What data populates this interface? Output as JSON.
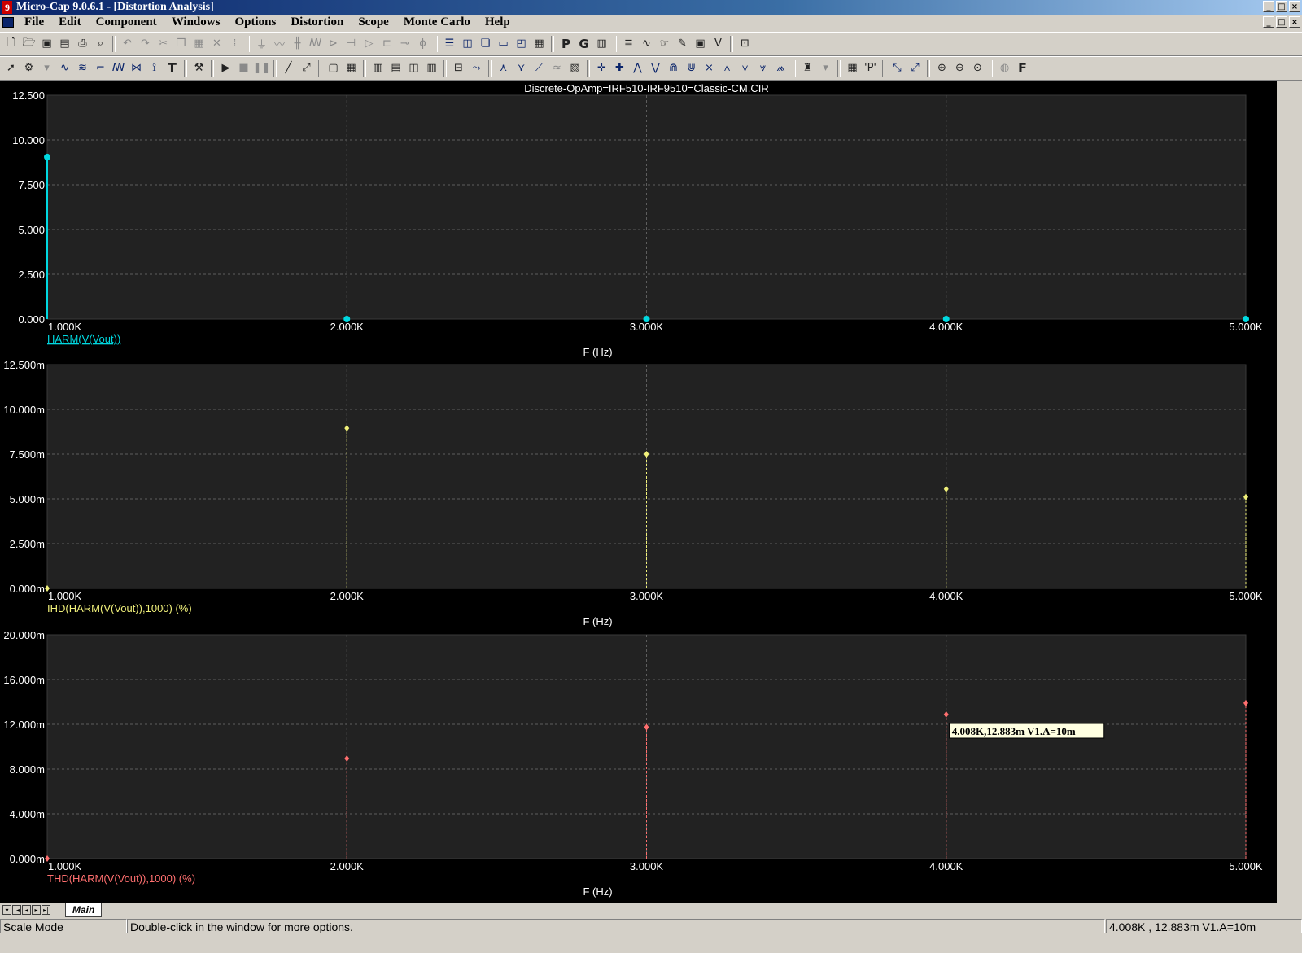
{
  "app": {
    "title": "Micro-Cap 9.0.6.1 - [Distortion Analysis]",
    "window_buttons": [
      "_",
      "□",
      "×"
    ]
  },
  "menu": {
    "items": [
      "File",
      "Edit",
      "Component",
      "Windows",
      "Options",
      "Distortion",
      "Scope",
      "Monte Carlo",
      "Help"
    ]
  },
  "toolbar": {
    "row1_icons": [
      "new-file-icon",
      "open-file-icon",
      "save-icon",
      "save-all-icon",
      "print-icon",
      "print-preview-icon",
      "undo-icon",
      "redo-icon",
      "cut-icon",
      "copy-icon",
      "paste-icon",
      "delete-icon",
      "select-all-icon",
      "ground-icon",
      "resistor-icon",
      "capacitor-icon",
      "inductor-icon",
      "diode-icon",
      "npn-icon",
      "opamp-icon",
      "window-split-icon",
      "calculator-icon",
      "probe-p-icon",
      "probe-g-icon",
      "grid-icon",
      "chart-icon"
    ],
    "row2_icons": [
      "select-arrow-icon",
      "component-mode-icon",
      "wire-icon",
      "text-tool-icon",
      "run-icon",
      "stop-icon",
      "pause-icon",
      "zoom-in-icon",
      "zoom-out-icon",
      "zoom-fit-icon",
      "font-f-icon"
    ],
    "font_label": "F",
    "probe_p": "P",
    "probe_g": "G"
  },
  "plot": {
    "title": "Discrete-OpAmp=IRF510-IRF9510=Classic-CM.CIR",
    "x_axis_label": "F (Hz)",
    "x_ticks": [
      "1.000K",
      "2.000K",
      "3.000K",
      "4.000K",
      "5.000K"
    ],
    "cursor_readout": "4.008K,12.883m V1.A=10m"
  },
  "chart_data": [
    {
      "type": "scatter",
      "style": "stem",
      "series": [
        {
          "name": "HARM(V(Vout))",
          "color": "#00d8e0",
          "values": [
            9.05,
            0.0,
            0.0,
            0.0,
            0.0
          ]
        }
      ],
      "x": [
        1000,
        2000,
        3000,
        4000,
        5000
      ],
      "xlabel": "F (Hz)",
      "ylim": [
        0,
        12.5
      ],
      "y_ticks": [
        "0.000",
        "2.500",
        "5.000",
        "7.500",
        "10.000",
        "12.500"
      ],
      "xlim": [
        1000,
        5000
      ],
      "grid": true
    },
    {
      "type": "scatter",
      "style": "stem",
      "series": [
        {
          "name": "IHD(HARM(V(Vout)),1000) (%)",
          "color": "#f0f07a",
          "values": [
            0.0,
            8.95,
            7.5,
            5.55,
            5.1
          ]
        }
      ],
      "x": [
        1000,
        2000,
        3000,
        4000,
        5000
      ],
      "xlabel": "F (Hz)",
      "ylim": [
        0,
        12.5
      ],
      "y_ticks": [
        "0.000m",
        "2.500m",
        "5.000m",
        "7.500m",
        "10.000m",
        "12.500m"
      ],
      "xlim": [
        1000,
        5000
      ],
      "grid": true
    },
    {
      "type": "scatter",
      "style": "stem",
      "series": [
        {
          "name": "THD(HARM(V(Vout)),1000) (%)",
          "color": "#ff6f6f",
          "values": [
            0.0,
            8.95,
            11.75,
            12.883,
            13.9
          ]
        }
      ],
      "x": [
        1000,
        2000,
        3000,
        4000,
        5000
      ],
      "xlabel": "F (Hz)",
      "ylim": [
        0,
        20
      ],
      "y_ticks": [
        "0.000m",
        "4.000m",
        "8.000m",
        "12.000m",
        "16.000m",
        "20.000m"
      ],
      "xlim": [
        1000,
        5000
      ],
      "grid": true
    }
  ],
  "tabs": {
    "nav": [
      "▾",
      "|◂",
      "◂",
      "▸",
      "▸|"
    ],
    "active": "Main"
  },
  "status": {
    "mode": "Scale Mode",
    "hint": "Double-click in the window for more options.",
    "readout": "4.008K , 12.883m  V1.A=10m"
  }
}
